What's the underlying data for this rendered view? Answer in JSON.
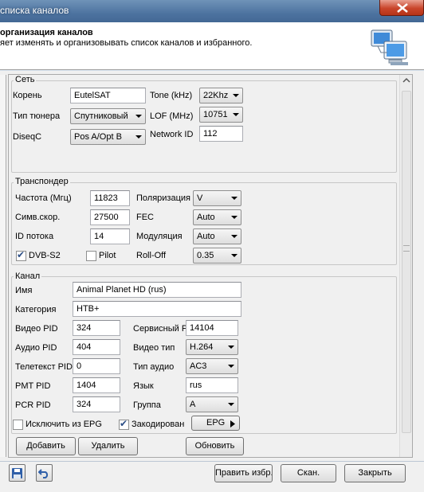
{
  "window": {
    "title": "списка каналов"
  },
  "header": {
    "title": "организация каналов",
    "description": "яет изменять и организовывать список каналов и избранного."
  },
  "sections": {
    "net": {
      "legend": "Сеть",
      "root_label": "Корень",
      "root_value": "EutelSAT",
      "tone_label": "Tone (kHz)",
      "tone_value": "22Khz",
      "tuner_type_label": "Тип тюнера",
      "tuner_type_value": "Спутниковый",
      "lof_label": "LOF  (MHz)",
      "lof_value": "10751",
      "diseqc_label": "DiseqC",
      "diseqc_value": "Pos A/Opt B",
      "network_id_label": "Network ID",
      "network_id_value": "112"
    },
    "transponder": {
      "legend": "Транспондер",
      "freq_label": "Частота (Мгц)",
      "freq_value": "11823",
      "polarization_label": "Поляризация",
      "polarization_value": "V",
      "symrate_label": "Симв.скор.",
      "symrate_value": "27500",
      "fec_label": "FEC",
      "fec_value": "Auto",
      "stream_id_label": "ID потока",
      "stream_id_value": "14",
      "modulation_label": "Модуляция",
      "modulation_value": "Auto",
      "dvbs2_label": "DVB-S2",
      "dvbs2_checked": true,
      "pilot_label": "Pilot",
      "pilot_checked": false,
      "rolloff_label": "Roll-Off",
      "rolloff_value": "0.35"
    },
    "channel": {
      "legend": "Канал",
      "name_label": "Имя",
      "name_value": "Animal Planet HD (rus)",
      "category_label": "Категория",
      "category_value": "НТВ+",
      "video_pid_label": "Видео PID",
      "video_pid_value": "324",
      "service_label": "Сервисный P",
      "service_value": "14104",
      "audio_pid_label": "Аудио PID",
      "audio_pid_value": "404",
      "video_type_label": "Видео тип",
      "video_type_value": "H.264",
      "teletext_label": "Телетекст PID",
      "teletext_value": "0",
      "audio_type_label": "Тип аудио",
      "audio_type_value": "AC3",
      "pmt_label": "PMT PID",
      "pmt_value": "1404",
      "language_label": "Язык",
      "language_value": "rus",
      "pcr_label": "PCR PID",
      "pcr_value": "324",
      "group_label": "Группа",
      "group_value": "A",
      "exclude_epg_label": "Исключить из EPG",
      "exclude_epg_checked": false,
      "encoded_label": "Закодирован",
      "encoded_checked": true,
      "epg_button": "EPG"
    }
  },
  "actions": {
    "add": "Добавить",
    "delete": "Удалить",
    "update": "Обновить"
  },
  "footer": {
    "edit_favorites": "Править избр.",
    "scan": "Скан.",
    "close": "Закрыть"
  },
  "icons": {
    "header_icon": "computers-network-icon",
    "save": "floppy-disk-icon",
    "undo": "undo-icon"
  }
}
